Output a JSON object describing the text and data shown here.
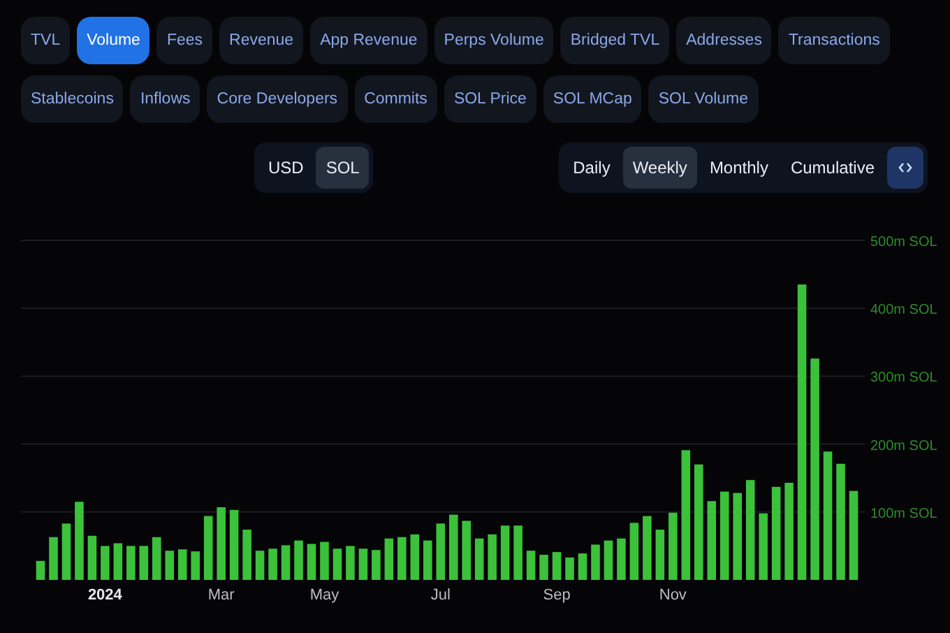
{
  "metric_tab_rows": [
    {
      "tabs": [
        {
          "label": "TVL",
          "selected": false
        },
        {
          "label": "Volume",
          "selected": true
        },
        {
          "label": "Fees",
          "selected": false
        },
        {
          "label": "Revenue",
          "selected": false
        },
        {
          "label": "App Revenue",
          "selected": false
        },
        {
          "label": "Perps Volume",
          "selected": false
        },
        {
          "label": "Bridged TVL",
          "selected": false
        },
        {
          "label": "Addresses",
          "selected": false
        },
        {
          "label": "Transactions",
          "selected": false
        }
      ]
    },
    {
      "tabs": [
        {
          "label": "Stablecoins",
          "selected": false
        },
        {
          "label": "Inflows",
          "selected": false
        },
        {
          "label": "Core Developers",
          "selected": false
        },
        {
          "label": "Commits",
          "selected": false
        },
        {
          "label": "SOL Price",
          "selected": false
        },
        {
          "label": "SOL MCap",
          "selected": false
        },
        {
          "label": "SOL Volume",
          "selected": false
        }
      ]
    }
  ],
  "denomination": [
    {
      "label": "USD",
      "selected": false
    },
    {
      "label": "SOL",
      "selected": true
    }
  ],
  "period": [
    {
      "label": "Daily",
      "selected": false
    },
    {
      "label": "Weekly",
      "selected": true
    },
    {
      "label": "Monthly",
      "selected": false
    },
    {
      "label": "Cumulative",
      "selected": false
    }
  ],
  "chart": {
    "chart_data": {
      "type": "bar",
      "categories": [
        null,
        null,
        null,
        null,
        null,
        "2024",
        null,
        null,
        null,
        null,
        null,
        null,
        null,
        null,
        "Mar",
        null,
        null,
        null,
        null,
        null,
        null,
        null,
        "May",
        null,
        null,
        null,
        null,
        null,
        null,
        null,
        null,
        "Jul",
        null,
        null,
        null,
        null,
        null,
        null,
        null,
        null,
        "Sep",
        null,
        null,
        null,
        null,
        null,
        null,
        null,
        null,
        "Nov",
        null,
        null,
        null,
        null,
        null,
        null,
        null,
        null,
        null,
        null,
        null,
        null,
        null,
        null
      ],
      "values": [
        28,
        63,
        83,
        115,
        65,
        50,
        54,
        50,
        50,
        63,
        43,
        45,
        42,
        94,
        107,
        103,
        74,
        43,
        46,
        51,
        58,
        53,
        56,
        46,
        50,
        46,
        44,
        61,
        63,
        67,
        58,
        83,
        96,
        87,
        61,
        67,
        80,
        80,
        43,
        37,
        41,
        33,
        39,
        52,
        58,
        61,
        84,
        94,
        74,
        99,
        191,
        170,
        116,
        130,
        128,
        147,
        98,
        137,
        143,
        435,
        326,
        189,
        171,
        131
      ],
      "ylim": [
        0,
        500
      ],
      "grid": true,
      "yticks": [
        {
          "value": 100,
          "label": "100m SOL"
        },
        {
          "value": 200,
          "label": "200m SOL"
        },
        {
          "value": 300,
          "label": "300m SOL"
        },
        {
          "value": 400,
          "label": "400m SOL"
        },
        {
          "value": 500,
          "label": "500m SOL"
        }
      ]
    }
  }
}
